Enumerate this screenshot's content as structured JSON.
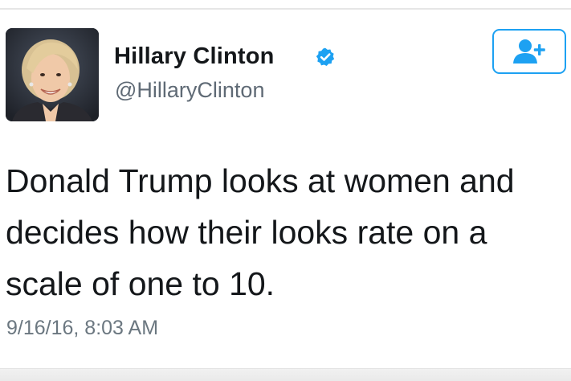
{
  "tweet": {
    "author": {
      "name": "Hillary Clinton",
      "handle": "@HillaryClinton",
      "verified": true
    },
    "text_lines": [
      "Donald Trump looks at women and",
      "decides how their looks rate on a",
      "scale of one to 10."
    ],
    "timestamp": "9/16/16, 8:03 AM"
  },
  "icons": {
    "verified": "verified-badge-icon",
    "follow": "add-user-icon"
  },
  "colors": {
    "accent": "#1da1f2",
    "text": "#14171a",
    "secondary": "#5f6a75"
  }
}
